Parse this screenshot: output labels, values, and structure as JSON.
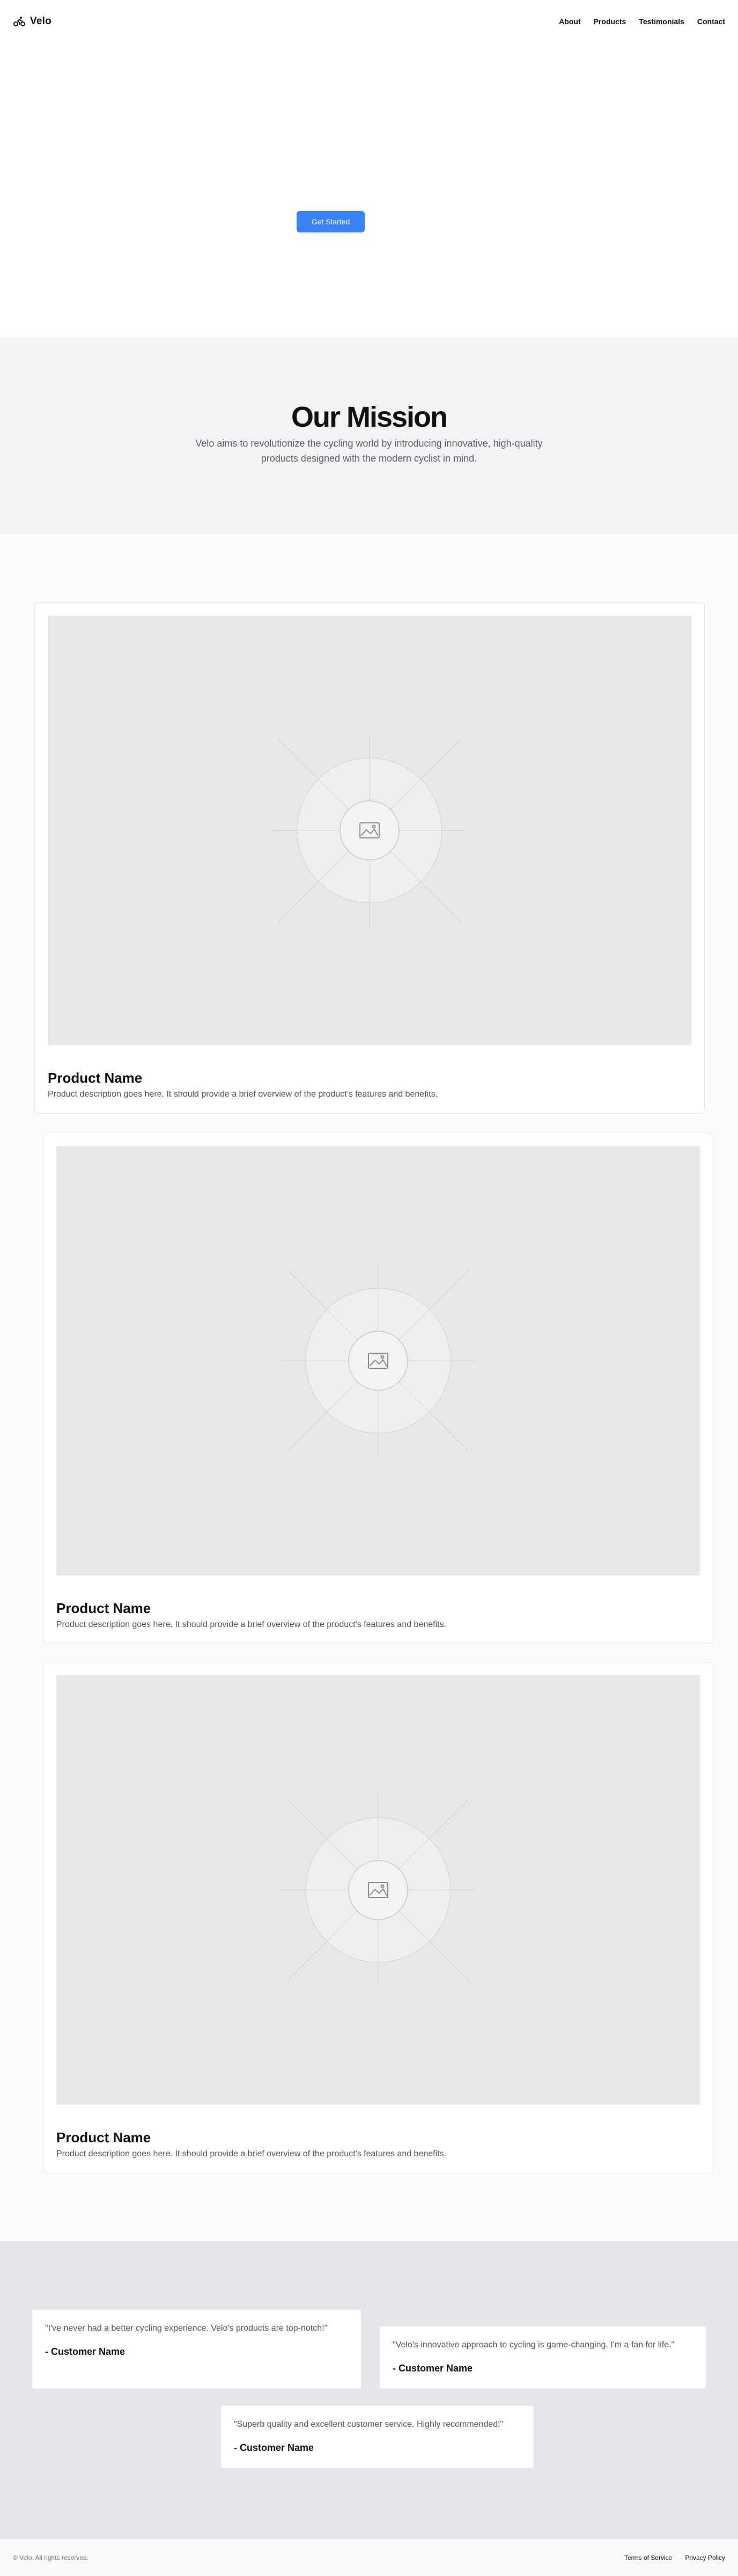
{
  "brand": {
    "name": "Velo",
    "logo_icon": "bicycle-icon"
  },
  "nav": {
    "items": [
      "About",
      "Products",
      "Testimonials",
      "Contact"
    ]
  },
  "hero": {
    "cta_label": "Get Started"
  },
  "mission": {
    "title": "Our Mission",
    "text": "Velo aims to revolutionize the cycling world by introducing innovative, high-quality products designed with the modern cyclist in mind."
  },
  "products": [
    {
      "name": "Product Name",
      "description": "Product description goes here. It should provide a brief overview of the product's features and benefits.",
      "image_icon": "image-placeholder-icon"
    },
    {
      "name": "Product Name",
      "description": "Product description goes here. It should provide a brief overview of the product's features and benefits.",
      "image_icon": "image-placeholder-icon"
    },
    {
      "name": "Product Name",
      "description": "Product description goes here. It should provide a brief overview of the product's features and benefits.",
      "image_icon": "image-placeholder-icon"
    }
  ],
  "testimonials": [
    {
      "quote": "\"I've never had a better cycling experience. Velo's products are top-notch!\"",
      "author": "- Customer Name"
    },
    {
      "quote": "\"Velo's innovative approach to cycling is game-changing. I'm a fan for life.\"",
      "author": "- Customer Name"
    },
    {
      "quote": "\"Superb quality and excellent customer service. Highly recommended!\"",
      "author": "- Customer Name"
    }
  ],
  "footer": {
    "copyright": "© Velo. All rights reserved.",
    "links": [
      "Terms of Service",
      "Privacy Policy"
    ]
  },
  "colors": {
    "accent": "#3b82f6",
    "mission_bg": "#f2f3f5",
    "testimonials_bg": "#e5e6e9",
    "placeholder_bg": "#e8e8e8"
  }
}
